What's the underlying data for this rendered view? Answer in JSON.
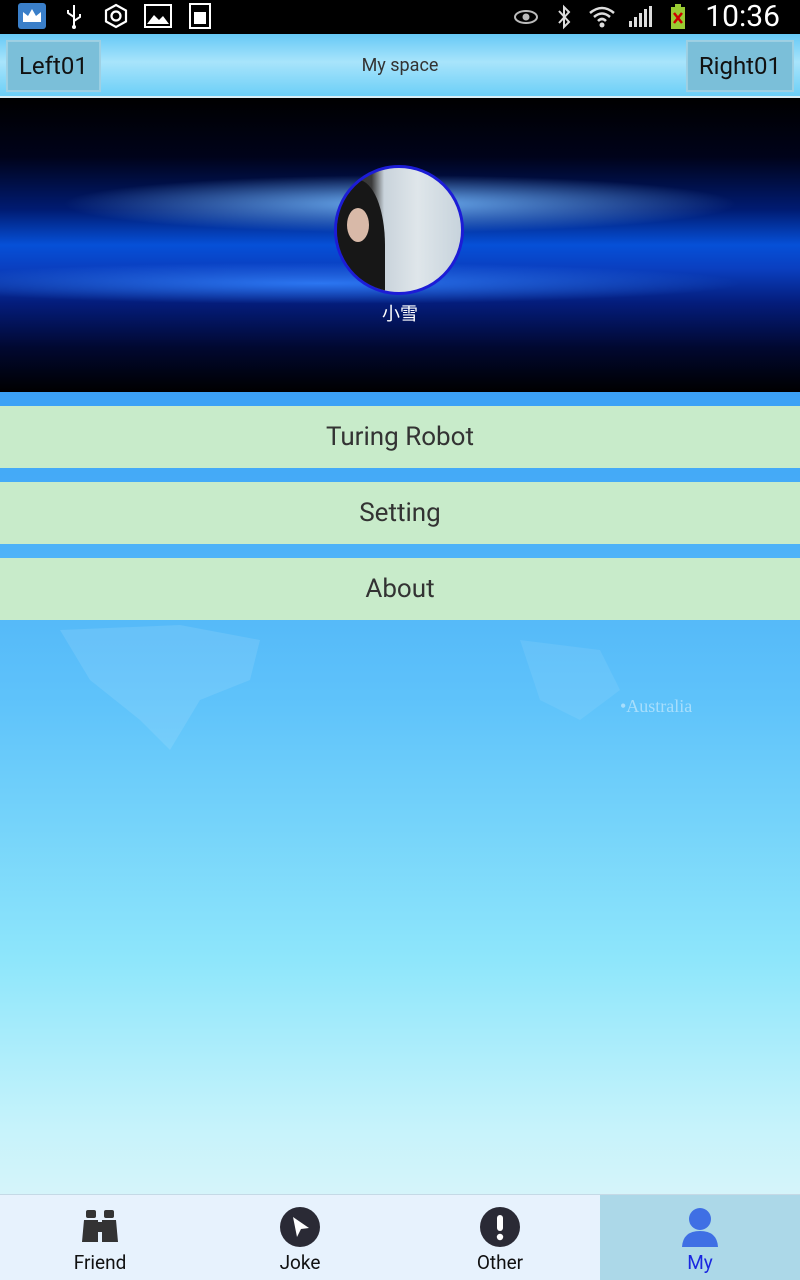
{
  "status_bar": {
    "time": "10:36",
    "left_icons": [
      "crown-app-icon",
      "usb-icon",
      "settings-circle-icon",
      "gallery-icon",
      "sd-card-icon"
    ],
    "right_icons": [
      "eye-icon",
      "bluetooth-icon",
      "wifi-icon",
      "signal-icon",
      "battery-icon"
    ]
  },
  "title_bar": {
    "left_button": "Left01",
    "title": "My space",
    "right_button": "Right01"
  },
  "profile": {
    "username": "小雪"
  },
  "menu": {
    "items": [
      {
        "label": "Turing Robot"
      },
      {
        "label": "Setting"
      },
      {
        "label": "About"
      }
    ]
  },
  "background_labels": {
    "map_text": "•Australia"
  },
  "bottom_nav": {
    "items": [
      {
        "label": "Friend",
        "icon": "binoculars-icon"
      },
      {
        "label": "Joke",
        "icon": "navigation-arrow-icon"
      },
      {
        "label": "Other",
        "icon": "exclamation-icon"
      },
      {
        "label": "My",
        "icon": "user-icon"
      }
    ],
    "active_index": 3
  },
  "colors": {
    "menu_bg": "#c8ebca",
    "active_tab_bg": "#acd8e8",
    "active_tab_label": "#1a27e0"
  }
}
